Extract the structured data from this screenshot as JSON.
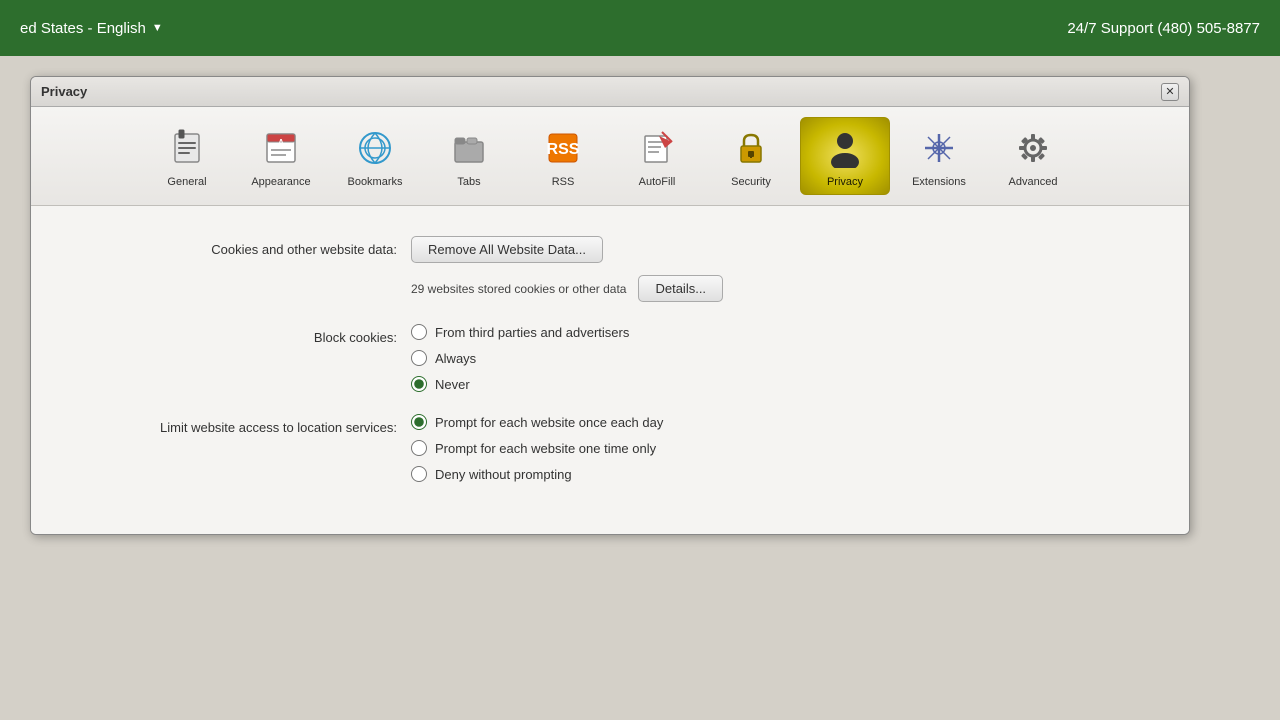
{
  "header": {
    "location": "ed States - English",
    "dropdown_arrow": "▼",
    "support_text": "24/7 Support (480) 505-8877"
  },
  "dialog": {
    "title": "Privacy",
    "close_label": "✕"
  },
  "toolbar": {
    "items": [
      {
        "id": "general",
        "label": "General",
        "icon": "general"
      },
      {
        "id": "appearance",
        "label": "Appearance",
        "icon": "appearance"
      },
      {
        "id": "bookmarks",
        "label": "Bookmarks",
        "icon": "bookmarks"
      },
      {
        "id": "tabs",
        "label": "Tabs",
        "icon": "tabs"
      },
      {
        "id": "rss",
        "label": "RSS",
        "icon": "rss"
      },
      {
        "id": "autofill",
        "label": "AutoFill",
        "icon": "autofill"
      },
      {
        "id": "security",
        "label": "Security",
        "icon": "security"
      },
      {
        "id": "privacy",
        "label": "Privacy",
        "icon": "privacy",
        "active": true
      },
      {
        "id": "extensions",
        "label": "Extensions",
        "icon": "extensions"
      },
      {
        "id": "advanced",
        "label": "Advanced",
        "icon": "advanced"
      }
    ]
  },
  "content": {
    "cookies_label": "Cookies and other website data:",
    "remove_btn": "Remove All Website Data...",
    "website_count": "29 websites stored cookies or other data",
    "details_btn": "Details...",
    "block_cookies_label": "Block cookies:",
    "block_cookies_options": [
      {
        "id": "third-party",
        "label": "From third parties and advertisers",
        "checked": false
      },
      {
        "id": "always",
        "label": "Always",
        "checked": false
      },
      {
        "id": "never",
        "label": "Never",
        "checked": true
      }
    ],
    "location_label": "Limit website access to location services:",
    "location_options": [
      {
        "id": "prompt-daily",
        "label": "Prompt for each website once each day",
        "checked": true
      },
      {
        "id": "prompt-once",
        "label": "Prompt for each website one time only",
        "checked": false
      },
      {
        "id": "deny",
        "label": "Deny without prompting",
        "checked": false
      }
    ]
  }
}
